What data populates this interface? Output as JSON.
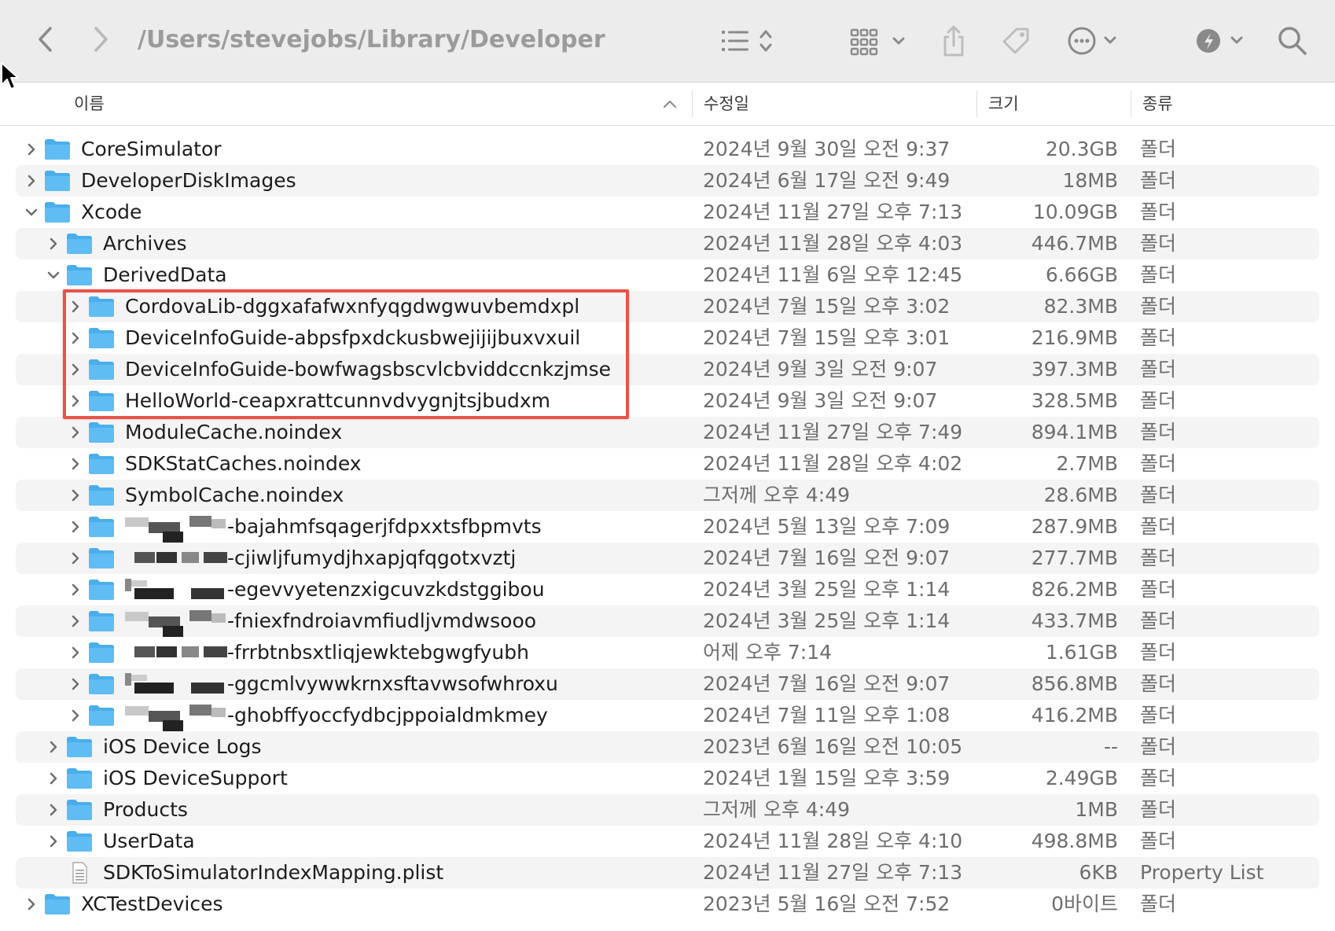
{
  "toolbar": {
    "path": "/Users/stevejobs/Library/Developer",
    "icons": [
      "back-icon",
      "forward-icon",
      "list-view-icon",
      "group-icon",
      "share-icon",
      "tag-icon",
      "more-icon",
      "action-icon",
      "search-icon"
    ]
  },
  "columns": {
    "name": "이름",
    "date": "수정일",
    "size": "크기",
    "kind": "종류"
  },
  "rows": [
    {
      "name": "CoreSimulator",
      "date": "2024년 9월 30일 오전 9:37",
      "size": "20.3GB",
      "kind": "폴더",
      "level": 0,
      "expanded": false,
      "type": "folder"
    },
    {
      "name": "DeveloperDiskImages",
      "date": "2024년 6월 17일 오전 9:49",
      "size": "18MB",
      "kind": "폴더",
      "level": 0,
      "expanded": false,
      "type": "folder"
    },
    {
      "name": "Xcode",
      "date": "2024년 11월 27일 오후 7:13",
      "size": "10.09GB",
      "kind": "폴더",
      "level": 0,
      "expanded": true,
      "type": "folder"
    },
    {
      "name": "Archives",
      "date": "2024년 11월 28일 오후 4:03",
      "size": "446.7MB",
      "kind": "폴더",
      "level": 1,
      "expanded": false,
      "type": "folder"
    },
    {
      "name": "DerivedData",
      "date": "2024년 11월 6일 오후 12:45",
      "size": "6.66GB",
      "kind": "폴더",
      "level": 1,
      "expanded": true,
      "type": "folder"
    },
    {
      "name": "CordovaLib-dggxafafwxnfyqgdwgwuvbemdxpl",
      "date": "2024년 7월 15일 오후 3:02",
      "size": "82.3MB",
      "kind": "폴더",
      "level": 2,
      "expanded": false,
      "type": "folder"
    },
    {
      "name": "DeviceInfoGuide-abpsfpxdckusbwejijijbuxvxuil",
      "date": "2024년 7월 15일 오후 3:01",
      "size": "216.9MB",
      "kind": "폴더",
      "level": 2,
      "expanded": false,
      "type": "folder"
    },
    {
      "name": "DeviceInfoGuide-bowfwagsbscvlcbviddccnkzjmse",
      "date": "2024년 9월 3일 오전 9:07",
      "size": "397.3MB",
      "kind": "폴더",
      "level": 2,
      "expanded": false,
      "type": "folder"
    },
    {
      "name": "HelloWorld-ceapxrattcunnvdvygnjtsjbudxm",
      "date": "2024년 9월 3일 오전 9:07",
      "size": "328.5MB",
      "kind": "폴더",
      "level": 2,
      "expanded": false,
      "type": "folder"
    },
    {
      "name": "ModuleCache.noindex",
      "date": "2024년 11월 27일 오후 7:49",
      "size": "894.1MB",
      "kind": "폴더",
      "level": 2,
      "expanded": false,
      "type": "folder"
    },
    {
      "name": "SDKStatCaches.noindex",
      "date": "2024년 11월 28일 오후 4:02",
      "size": "2.7MB",
      "kind": "폴더",
      "level": 2,
      "expanded": false,
      "type": "folder"
    },
    {
      "name": "SymbolCache.noindex",
      "date": "그저께 오후 4:49",
      "size": "28.6MB",
      "kind": "폴더",
      "level": 2,
      "expanded": false,
      "type": "folder"
    },
    {
      "name": "-bajahmfsqagerjfdpxxtsfbpmvts",
      "date": "2024년 5월 13일 오후 7:09",
      "size": "287.9MB",
      "kind": "폴더",
      "level": 2,
      "expanded": false,
      "type": "folder",
      "redacted": 1
    },
    {
      "name": "-cjiwljfumydjhxapjqfqgotxvztj",
      "date": "2024년 7월 16일 오전 9:07",
      "size": "277.7MB",
      "kind": "폴더",
      "level": 2,
      "expanded": false,
      "type": "folder",
      "redacted": 2
    },
    {
      "name": "-egevvyetenzxigcuvzkdstggibou",
      "date": "2024년 3월 25일 오후 1:14",
      "size": "826.2MB",
      "kind": "폴더",
      "level": 2,
      "expanded": false,
      "type": "folder",
      "redacted": 3
    },
    {
      "name": "-fniexfndroiavmfiudljvmdwsooo",
      "date": "2024년 3월 25일 오후 1:14",
      "size": "433.7MB",
      "kind": "폴더",
      "level": 2,
      "expanded": false,
      "type": "folder",
      "redacted": 1
    },
    {
      "name": "-frrbtnbsxtliqjewktebgwgfyubh",
      "date": "어제 오후 7:14",
      "size": "1.61GB",
      "kind": "폴더",
      "level": 2,
      "expanded": false,
      "type": "folder",
      "redacted": 2
    },
    {
      "name": "-ggcmlvywwkrnxsftavwsofwhroxu",
      "date": "2024년 7월 16일 오전 9:07",
      "size": "856.8MB",
      "kind": "폴더",
      "level": 2,
      "expanded": false,
      "type": "folder",
      "redacted": 3
    },
    {
      "name": "-ghobffyoccfydbcjppoialdmkmey",
      "date": "2024년 7월 11일 오후 1:08",
      "size": "416.2MB",
      "kind": "폴더",
      "level": 2,
      "expanded": false,
      "type": "folder",
      "redacted": 1
    },
    {
      "name": "iOS Device Logs",
      "date": "2023년 6월 16일 오전 10:05",
      "size": "--",
      "kind": "폴더",
      "level": 1,
      "expanded": false,
      "type": "folder"
    },
    {
      "name": "iOS DeviceSupport",
      "date": "2024년 1월 15일 오후 3:59",
      "size": "2.49GB",
      "kind": "폴더",
      "level": 1,
      "expanded": false,
      "type": "folder"
    },
    {
      "name": "Products",
      "date": "그저께 오후 4:49",
      "size": "1MB",
      "kind": "폴더",
      "level": 1,
      "expanded": false,
      "type": "folder"
    },
    {
      "name": "UserData",
      "date": "2024년 11월 28일 오후 4:10",
      "size": "498.8MB",
      "kind": "폴더",
      "level": 1,
      "expanded": false,
      "type": "folder"
    },
    {
      "name": "SDKToSimulatorIndexMapping.plist",
      "date": "2024년 11월 27일 오후 7:13",
      "size": "6KB",
      "kind": "Property List",
      "level": 1,
      "expanded": false,
      "type": "file"
    },
    {
      "name": "XCTestDevices",
      "date": "2023년 5월 16일 오전 7:52",
      "size": "0바이트",
      "kind": "폴더",
      "level": 0,
      "expanded": false,
      "type": "folder"
    }
  ],
  "colors": {
    "folder_blue": "#4aaeeb",
    "highlight_red": "#e8534a",
    "stripe": "#f4f4f4",
    "toolbar_bg": "#ececec"
  }
}
